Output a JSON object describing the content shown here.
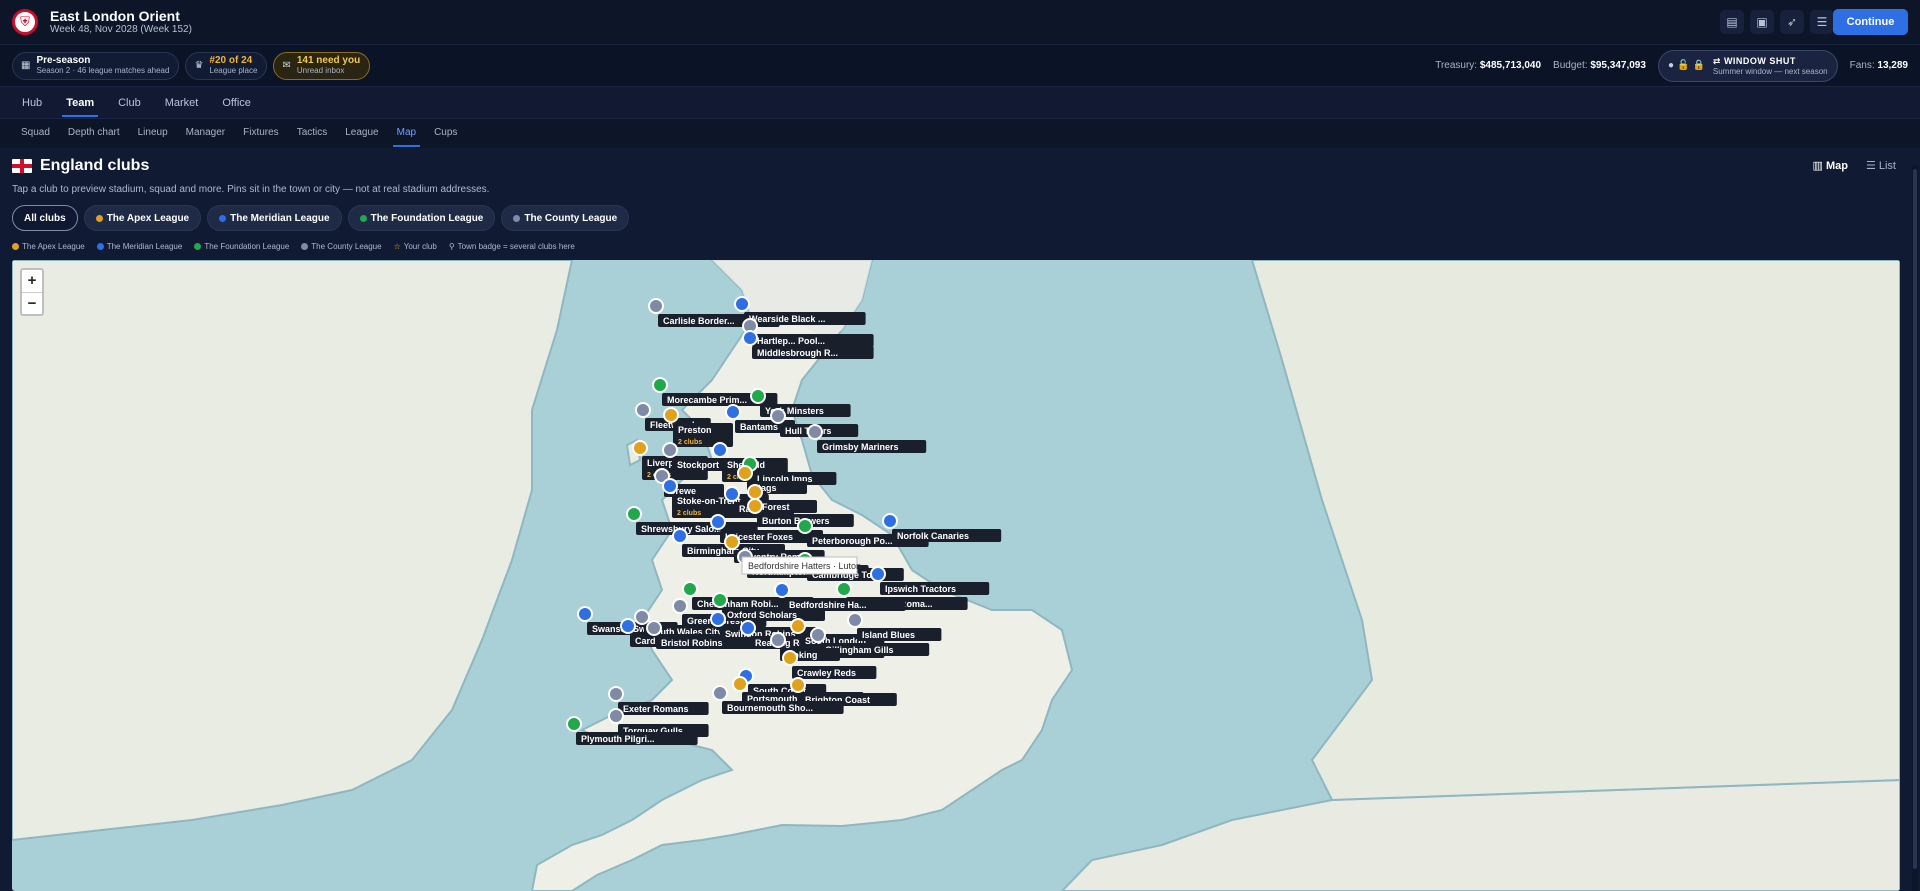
{
  "header": {
    "club_name": "East London Orient",
    "date_line": "Week 48, Nov 2028 (Week 152)",
    "continue_label": "Continue"
  },
  "status": {
    "phase_title": "Pre-season",
    "phase_sub": "Season 2 · 46 league matches ahead",
    "place_title": "#20 of 24",
    "place_sub": "League place",
    "inbox_title": "141 need you",
    "inbox_sub": "Unread inbox",
    "treasury_label": "Treasury:",
    "treasury_value": "$485,713,040",
    "budget_label": "Budget:",
    "budget_value": "$95,347,093",
    "window_title": "WINDOW SHUT",
    "window_sub": "Summer window — next season",
    "fans_label": "Fans:",
    "fans_value": "13,289"
  },
  "main_nav": [
    "Hub",
    "Team",
    "Club",
    "Market",
    "Office"
  ],
  "main_nav_active": "Team",
  "sub_nav": [
    "Squad",
    "Depth chart",
    "Lineup",
    "Manager",
    "Fixtures",
    "Tactics",
    "League",
    "Map",
    "Cups"
  ],
  "sub_nav_active": "Map",
  "page": {
    "title": "England clubs",
    "description": "Tap a club to preview stadium, squad and more. Pins sit in the town or city — not at real stadium addresses.",
    "view_map": "Map",
    "view_list": "List"
  },
  "filters": [
    {
      "label": "All clubs",
      "color": ""
    },
    {
      "label": "The Apex League",
      "color": "#e0a21c"
    },
    {
      "label": "The Meridian League",
      "color": "#2f6fe4"
    },
    {
      "label": "The Foundation League",
      "color": "#20a84a"
    },
    {
      "label": "The County League",
      "color": "#7f8aa6"
    }
  ],
  "legend": {
    "apex": "The Apex League",
    "meridian": "The Meridian League",
    "foundation": "The Foundation League",
    "county": "The County League",
    "your_club": "Your club",
    "town_badge": "Town badge = several clubs here"
  },
  "colors": {
    "apex": "#e0a21c",
    "meridian": "#2f6fe4",
    "foundation": "#20a84a",
    "county": "#7f8aa6",
    "accent": "#2f6fe4"
  },
  "tooltip": "Bedfordshire Hatters · Luton",
  "pins": [
    {
      "label": "Carlisle Border...",
      "league": "county"
    },
    {
      "label": "Wearside Black ...",
      "league": "meridian"
    },
    {
      "label": "Hartlep... Pool...",
      "league": "county"
    },
    {
      "label": "Middlesbrough R...",
      "league": "meridian"
    },
    {
      "label": "Morecambe Prim...",
      "league": "foundation"
    },
    {
      "label": "York Minsters",
      "league": "foundation"
    },
    {
      "label": "Fleetwood",
      "league": "county"
    },
    {
      "label": "Preston",
      "league": "apex",
      "sub": "2 clubs"
    },
    {
      "label": "Bantams",
      "league": "meridian"
    },
    {
      "label": "Hull Tigers",
      "league": "county"
    },
    {
      "label": "Grimsby Mariners",
      "league": "county"
    },
    {
      "label": "Liverpool",
      "league": "apex",
      "sub": "2 clubs"
    },
    {
      "label": "Stockport Hatts",
      "league": "county"
    },
    {
      "label": "Sheffield",
      "league": "meridian",
      "sub": "2 clubs"
    },
    {
      "label": "Lincoln Imps",
      "league": "foundation"
    },
    {
      "label": "Stags",
      "league": "apex"
    },
    {
      "label": "Crewe",
      "league": "county"
    },
    {
      "label": "Stoke-on-Trent",
      "league": "meridian",
      "sub": "2 clubs"
    },
    {
      "label": "Rams",
      "league": "meridian"
    },
    {
      "label": "Forest",
      "league": "apex"
    },
    {
      "label": "Shrewsbury Salo...",
      "league": "foundation"
    },
    {
      "label": "Burton Brewers",
      "league": "apex"
    },
    {
      "label": "Leicester Foxes",
      "league": "meridian"
    },
    {
      "label": "Peterborough Po...",
      "league": "foundation"
    },
    {
      "label": "Norfolk Canaries",
      "league": "meridian"
    },
    {
      "label": "Birmingham City",
      "league": "meridian"
    },
    {
      "label": "Coventry Rams",
      "league": "apex"
    },
    {
      "label": "Northampton Cob...",
      "league": "county"
    },
    {
      "label": "Cambridge Town",
      "league": "foundation"
    },
    {
      "label": "Ipswich Tractors",
      "league": "meridian"
    },
    {
      "label": "Colchester Roma...",
      "league": "foundation"
    },
    {
      "label": "Cheltenham Robi...",
      "league": "foundation"
    },
    {
      "label": "Bedfordshire Ha...",
      "league": "meridian"
    },
    {
      "label": "Green Forest",
      "league": "county"
    },
    {
      "label": "Oxford Scholars",
      "league": "foundation"
    },
    {
      "label": "Swansea Swans",
      "league": "meridian"
    },
    {
      "label": "South Wales City",
      "league": "county"
    },
    {
      "label": "Cardiff Blues",
      "league": "meridian"
    },
    {
      "label": "Bristol Robins",
      "league": "county"
    },
    {
      "label": "Swindon Robins",
      "league": "meridian"
    },
    {
      "label": "Reading Royals",
      "league": "meridian"
    },
    {
      "label": "South London",
      "league": "apex",
      "sub": "2 clubs"
    },
    {
      "label": "Island Blues",
      "league": "county"
    },
    {
      "label": "Gillingham Gills",
      "league": "county"
    },
    {
      "label": "Woking",
      "league": "county"
    },
    {
      "label": "Crawley Reds",
      "league": "apex"
    },
    {
      "label": "South Coast",
      "league": "meridian"
    },
    {
      "label": "Portsmouth Sail...",
      "league": "apex"
    },
    {
      "label": "Brighton Coast",
      "league": "apex"
    },
    {
      "label": "Bournemouth Sho...",
      "league": "county"
    },
    {
      "label": "Exeter Romans",
      "league": "county"
    },
    {
      "label": "Torquay Gulls",
      "league": "county"
    },
    {
      "label": "Plymouth Pilgri...",
      "league": "foundation"
    }
  ]
}
